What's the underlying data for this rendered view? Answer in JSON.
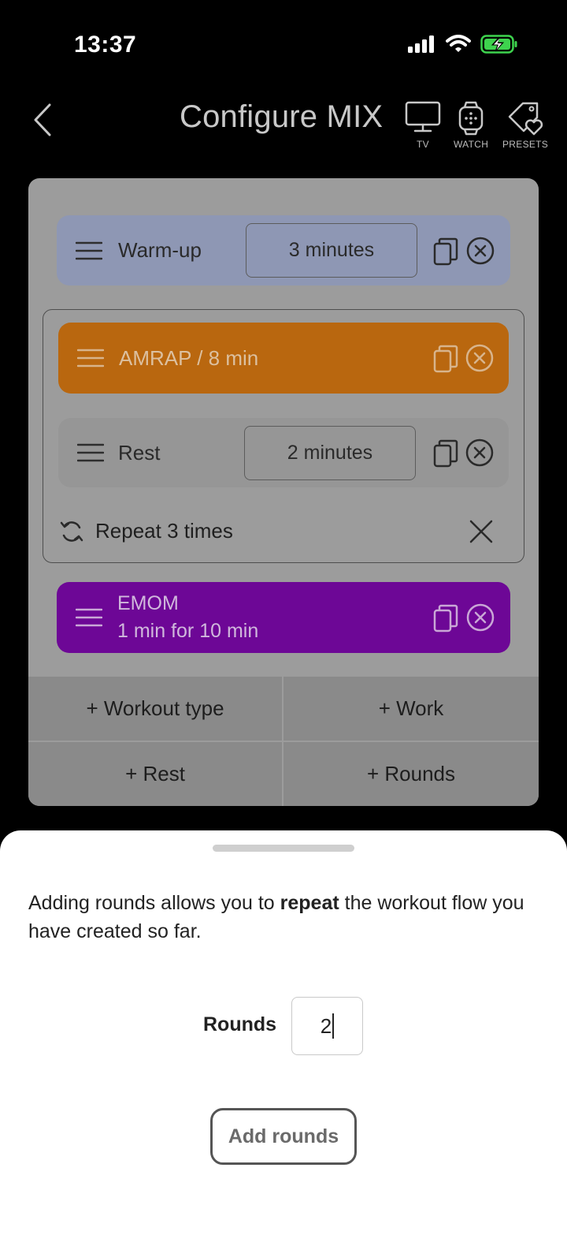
{
  "status": {
    "time": "13:37"
  },
  "header": {
    "title": "Configure MIX",
    "tv_label": "TV",
    "watch_label": "WATCH",
    "presets_label": "PRESETS"
  },
  "workout": {
    "warmup": {
      "label": "Warm-up",
      "duration": "3 minutes",
      "color": "#8e97b4"
    },
    "amrap": {
      "label": "AMRAP / 8 min",
      "color": "#b9670f"
    },
    "rest": {
      "label": "Rest",
      "duration": "2 minutes",
      "color": "#969696"
    },
    "repeat": {
      "label": "Repeat 3 times"
    },
    "emom": {
      "line1": "EMOM",
      "line2": "1 min for 10 min",
      "color": "#6d0796"
    }
  },
  "actions": {
    "workout_type": "+ Workout type",
    "work": "+ Work",
    "rest": "+ Rest",
    "rounds": "+ Rounds"
  },
  "sheet": {
    "text_before": "Adding rounds allows you to ",
    "text_bold": "repeat",
    "text_after": " the workout flow you have created so far.",
    "rounds_label": "Rounds",
    "rounds_value": "2",
    "add_button": "Add rounds"
  }
}
